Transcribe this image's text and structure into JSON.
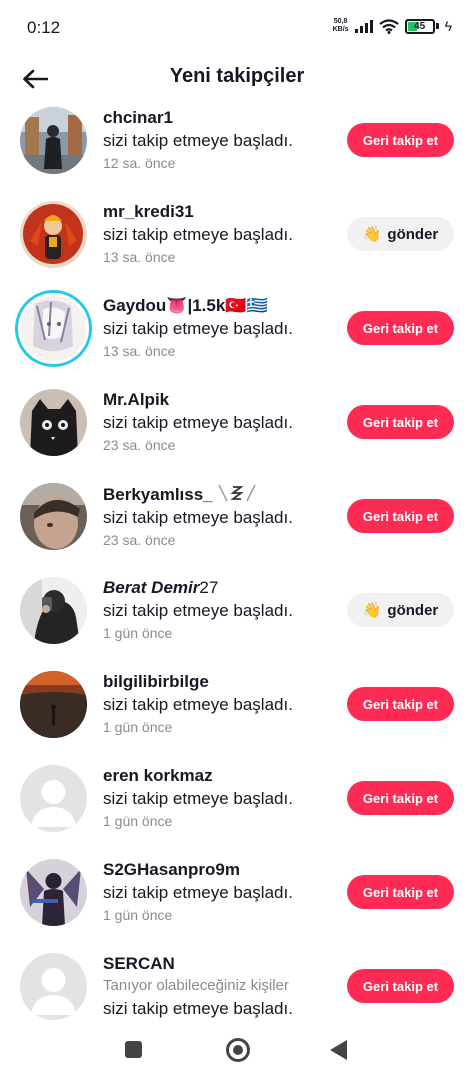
{
  "status_bar": {
    "time": "0:12",
    "net_speed_value": "50,8",
    "net_speed_unit": "KB/s",
    "battery": "45",
    "battery_percent": 45
  },
  "header": {
    "title": "Yeni takipçiler"
  },
  "colors": {
    "follow_button": "#fe2c55",
    "send_button": "#f1f1f2",
    "story_ring": "#25c8e8",
    "time_text": "#8a8b91"
  },
  "rows": [
    {
      "username": "chcinar1",
      "message": "sizi takip etmeye başladı.",
      "time": "12 sa. önce",
      "button": "Geri takip et"
    },
    {
      "username": "mr_kredi31",
      "message": "sizi takip etmeye başladı.",
      "time": "13 sa. önce",
      "button": "gönder",
      "button_icon": "👋"
    },
    {
      "username": "Gaydou👅|1.5k🇹🇷🇬🇷",
      "message": "sizi takip etmeye başladı.",
      "time": "13 sa. önce",
      "button": "Geri takip et"
    },
    {
      "username": "Mr.Alpik",
      "message": "sizi takip etmeye başladı.",
      "time": "23 sa. önce",
      "button": "Geri takip et"
    },
    {
      "username": "Berkyamlıss_",
      "message": "sizi takip etmeye başladı.",
      "time": "23 sa. önce",
      "button": "Geri takip et"
    },
    {
      "username_bold_italic": "Berat Demir",
      "username_suffix": "27",
      "message": "sizi takip etmeye başladı.",
      "time": "1 gün önce",
      "button": "gönder",
      "button_icon": "👋"
    },
    {
      "username": "bilgilibirbilge",
      "message": "sizi takip etmeye başladı.",
      "time": "1 gün önce",
      "button": "Geri takip et"
    },
    {
      "username": "eren korkmaz",
      "message": "sizi takip etmeye başladı.",
      "time": "1 gün önce",
      "button": "Geri takip et"
    },
    {
      "username": "S2GHasanpro9m",
      "message": "sizi takip etmeye başladı.",
      "time": "1 gün önce",
      "button": "Geri takip et"
    },
    {
      "username": "SERCAN",
      "suggestion": "Tanıyor olabileceğiniz kişiler",
      "message": "sizi takip etmeye başladı.",
      "button": "Geri takip et"
    }
  ]
}
